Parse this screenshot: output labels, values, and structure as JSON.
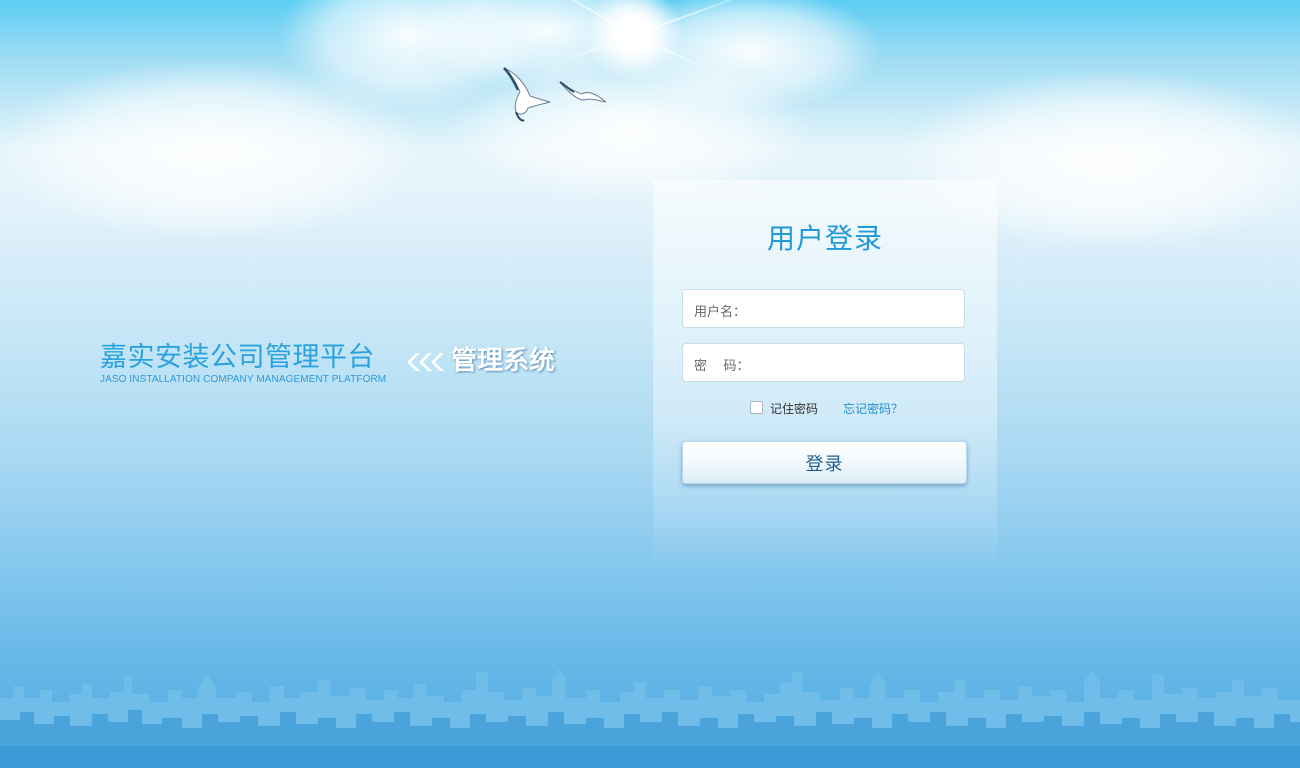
{
  "brand": {
    "title": "嘉实安装公司管理平台",
    "subtitle": "JASO INSTALLATION COMPANY MANAGEMENT PLATFORM",
    "system_title": "管理系统"
  },
  "login": {
    "title": "用户登录",
    "username_label": "用户名：",
    "username_value": "",
    "password_label": "密    码：",
    "password_value": "",
    "remember_label": "记住密码",
    "remember_checked": false,
    "forgot_label": "忘记密码？",
    "submit_label": "登录"
  },
  "colors": {
    "accent": "#1f9ad6",
    "sky_top": "#5ccdf3",
    "sky_bottom": "#4fa9e0",
    "skyline": "#3b9bd7"
  },
  "icons": {
    "chevrons": "triple-chevron-left-icon",
    "birds": "seagull-icon"
  }
}
